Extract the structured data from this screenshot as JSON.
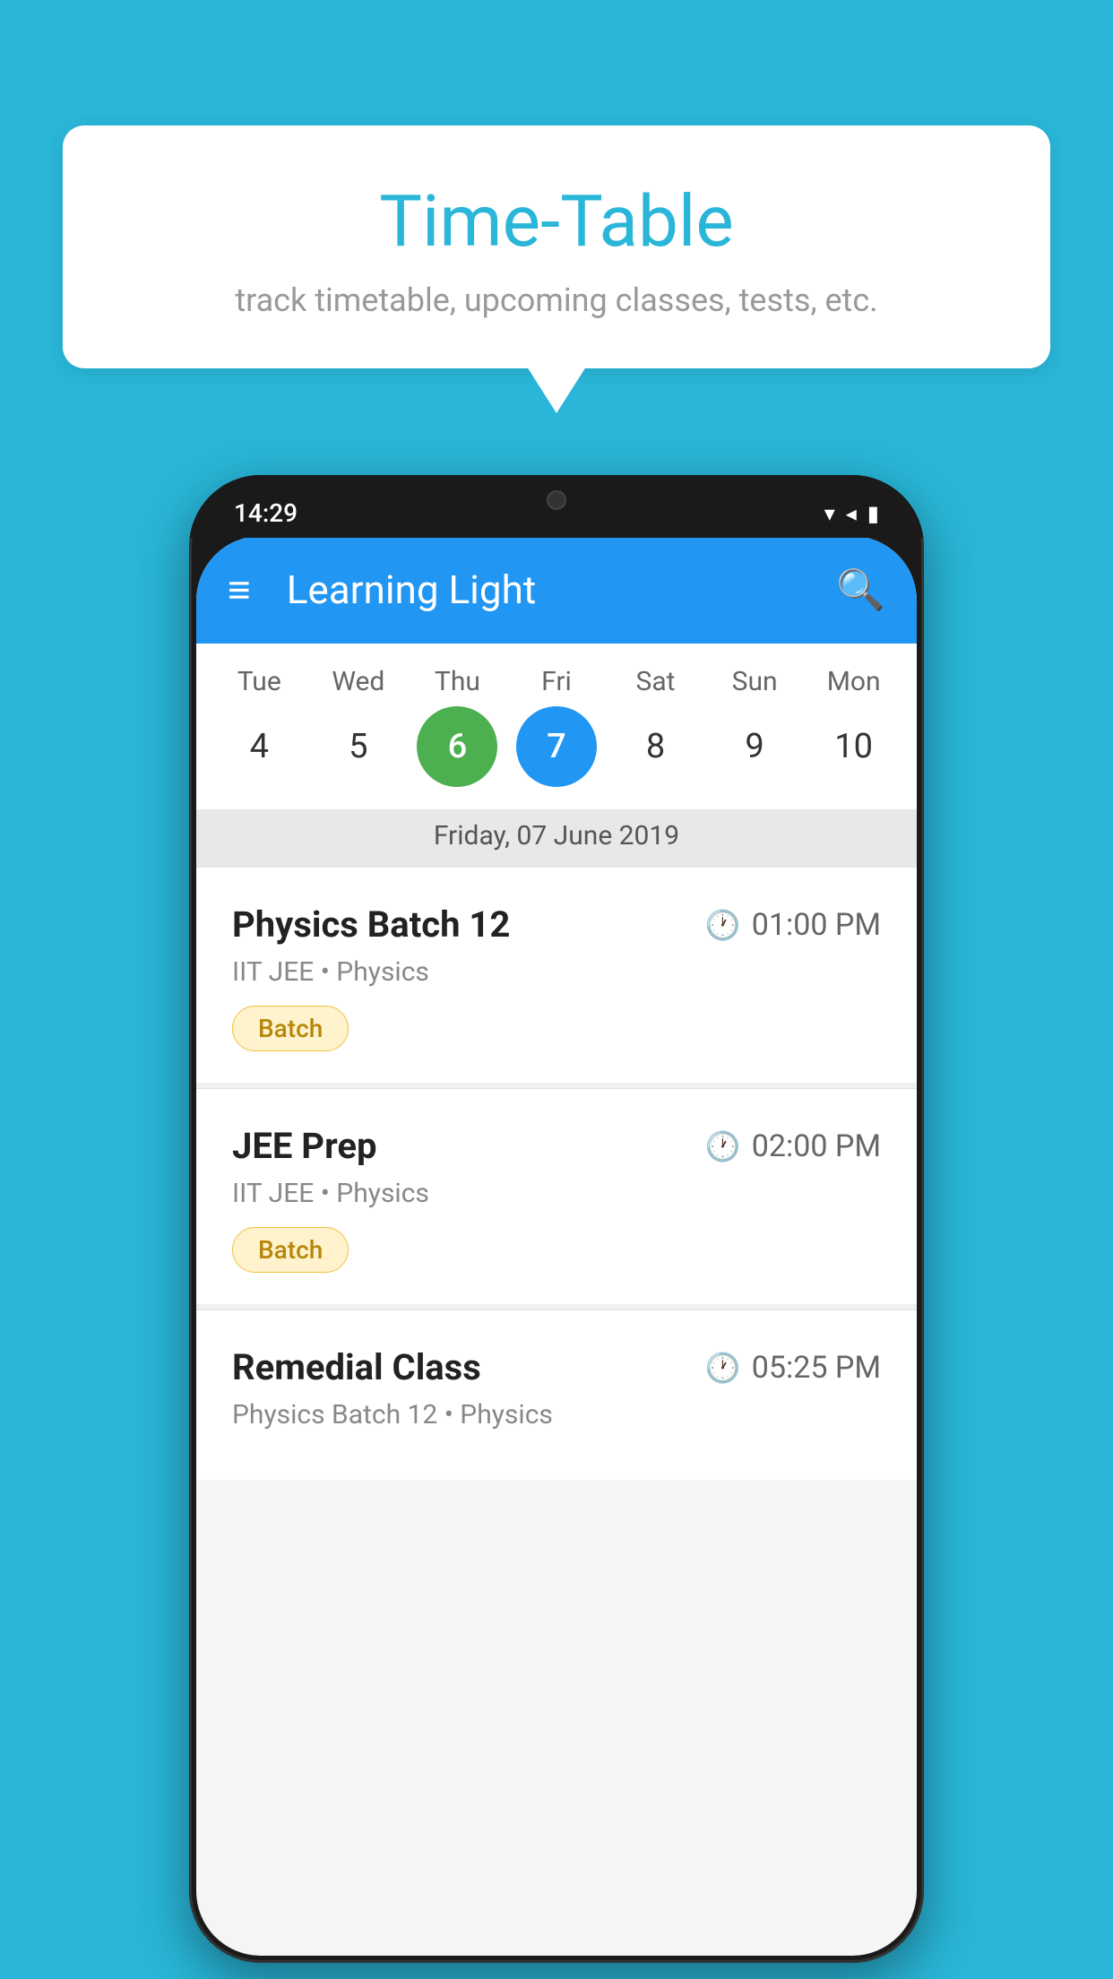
{
  "page": {
    "background_color": "#29B6D8"
  },
  "speech_bubble": {
    "title": "Time-Table",
    "subtitle": "track timetable, upcoming classes, tests, etc."
  },
  "phone": {
    "status_bar": {
      "time": "14:29"
    },
    "app_bar": {
      "title": "Learning Light"
    },
    "calendar": {
      "days": [
        {
          "label": "Tue",
          "number": "4"
        },
        {
          "label": "Wed",
          "number": "5"
        },
        {
          "label": "Thu",
          "number": "6",
          "state": "today"
        },
        {
          "label": "Fri",
          "number": "7",
          "state": "selected"
        },
        {
          "label": "Sat",
          "number": "8"
        },
        {
          "label": "Sun",
          "number": "9"
        },
        {
          "label": "Mon",
          "number": "10"
        }
      ],
      "selected_date": "Friday, 07 June 2019"
    },
    "schedule": [
      {
        "title": "Physics Batch 12",
        "time": "01:00 PM",
        "subtitle": "IIT JEE • Physics",
        "badge": "Batch"
      },
      {
        "title": "JEE Prep",
        "time": "02:00 PM",
        "subtitle": "IIT JEE • Physics",
        "badge": "Batch"
      },
      {
        "title": "Remedial Class",
        "time": "05:25 PM",
        "subtitle": "Physics Batch 12 • Physics",
        "badge": ""
      }
    ]
  }
}
